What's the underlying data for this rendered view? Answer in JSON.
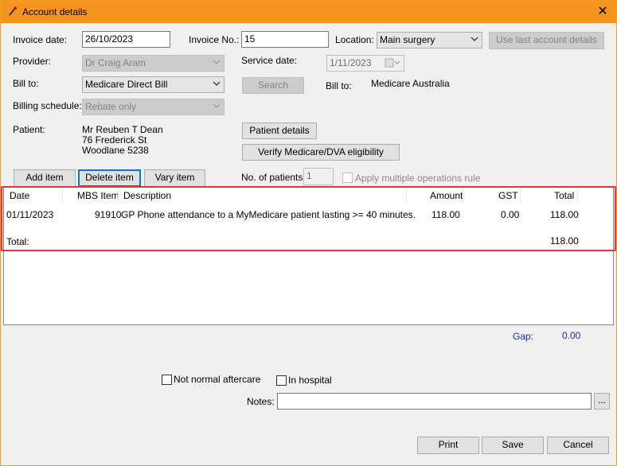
{
  "window": {
    "title": "Account details",
    "close_glyph": "✕"
  },
  "form": {
    "invoice_date_label": "Invoice date:",
    "invoice_date_value": "26/10/2023",
    "invoice_no_label": "Invoice No.:",
    "invoice_no_value": "15",
    "location_label": "Location:",
    "location_value": "Main surgery",
    "use_last_account_label": "Use last account details",
    "provider_label": "Provider:",
    "provider_value": "Dr Craig Aram",
    "service_date_label": "Service date:",
    "service_date_value": "1/11/2023",
    "bill_to_label": "Bill to:",
    "bill_to_value": "Medicare Direct Bill",
    "search_label": "Search",
    "bill_to_right_label": "Bill to:",
    "bill_to_right_value": "Medicare Australia",
    "billing_schedule_label": "Billing schedule:",
    "billing_schedule_value": "Rebate only",
    "patient_label": "Patient:",
    "patient_name": "Mr Reuben T Dean",
    "patient_address1": "76 Frederick St",
    "patient_address2": "Woodlane  5238",
    "patient_details_label": "Patient details",
    "verify_label": "Verify Medicare/DVA eligibility",
    "add_item_label": "Add item",
    "delete_item_label": "Delete item",
    "vary_item_label": "Vary item",
    "no_patients_label": "No. of patients:",
    "no_patients_value": "1",
    "apply_multiple_label": "Apply multiple operations rule"
  },
  "grid": {
    "columns": [
      "Date",
      "MBS Item",
      "Description",
      "Amount",
      "GST",
      "Total"
    ],
    "rows": [
      {
        "date": "01/11/2023",
        "mbs_item": "91910",
        "description": "GP Phone attendance to a MyMedicare patient lasting >= 40 minutes.",
        "amount": "118.00",
        "gst": "0.00",
        "total": "118.00"
      }
    ],
    "total_label": "Total:",
    "total_value": "118.00"
  },
  "footer": {
    "gap_label": "Gap:",
    "gap_value": "0.00",
    "not_normal_aftercare_label": "Not normal aftercare",
    "in_hospital_label": "In hospital",
    "notes_label": "Notes:",
    "notes_value": "",
    "notes_browse_label": "...",
    "print_label": "Print",
    "save_label": "Save",
    "cancel_label": "Cancel"
  },
  "colors": {
    "titlebar": "#f5941e",
    "highlight": "#e2363f",
    "gap": "#1a2fa0",
    "focus": "#0078d7"
  }
}
